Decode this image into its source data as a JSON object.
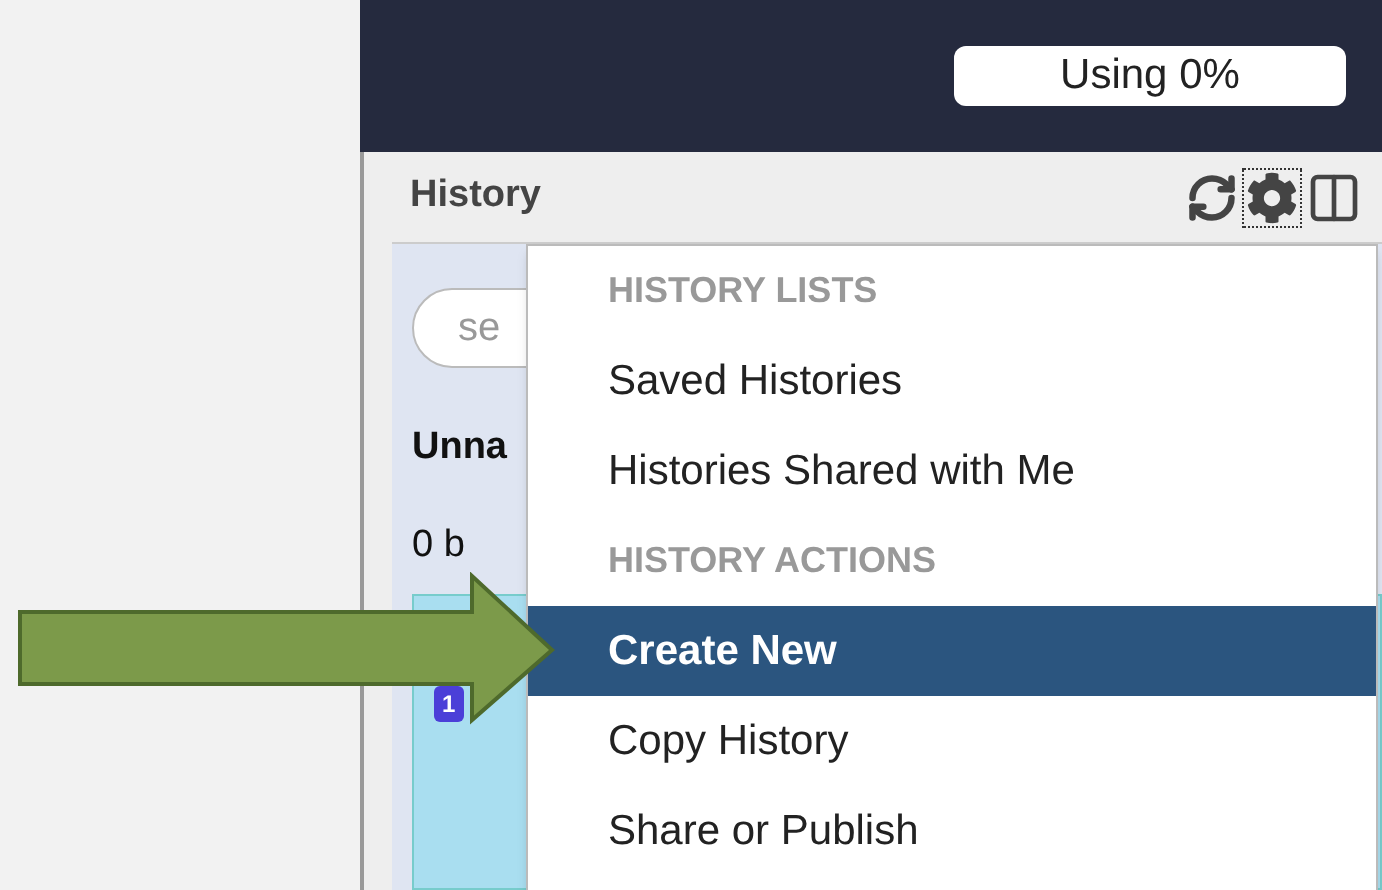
{
  "top_bar": {
    "usage": "Using 0%"
  },
  "history_panel": {
    "title": "History",
    "search": {
      "placeholder": "se"
    },
    "history_name": "Unna",
    "size": "0 b",
    "dataset": {
      "badge": "1"
    }
  },
  "menu": {
    "items": [
      {
        "kind": "header",
        "label": "HISTORY LISTS"
      },
      {
        "kind": "item",
        "label": "Saved Histories",
        "selected": false
      },
      {
        "kind": "item",
        "label": "Histories Shared with Me",
        "selected": false
      },
      {
        "kind": "header",
        "label": "HISTORY ACTIONS"
      },
      {
        "kind": "item",
        "label": "Create New",
        "selected": true
      },
      {
        "kind": "item",
        "label": "Copy History",
        "selected": false
      },
      {
        "kind": "item",
        "label": "Share or Publish",
        "selected": false
      }
    ]
  }
}
